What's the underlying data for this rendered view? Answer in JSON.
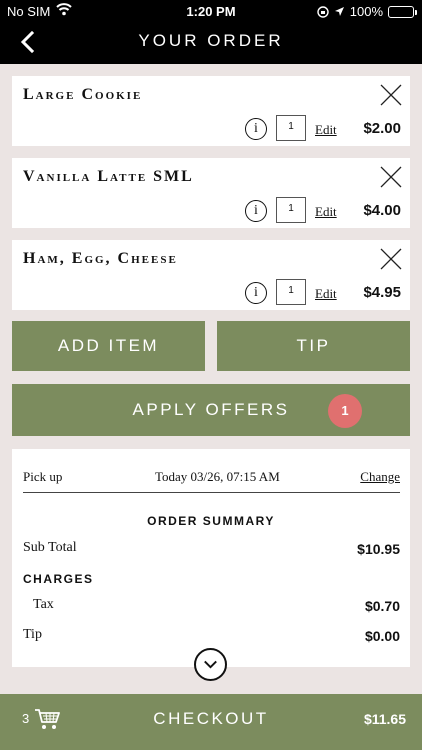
{
  "status_bar": {
    "carrier": "No SIM",
    "time": "1:20 PM",
    "battery": "100%"
  },
  "header": {
    "title": "YOUR ORDER"
  },
  "items": [
    {
      "name": "Large Cookie",
      "quantity": "1",
      "edit_label": "Edit",
      "price": "$2.00",
      "info_label": "i"
    },
    {
      "name": "Vanilla Latte SML",
      "quantity": "1",
      "edit_label": "Edit",
      "price": "$4.00",
      "info_label": "i"
    },
    {
      "name": "Ham, Egg, Cheese",
      "quantity": "1",
      "edit_label": "Edit",
      "price": "$4.95",
      "info_label": "i"
    }
  ],
  "actions": {
    "add_item": "ADD ITEM",
    "tip": "TIP",
    "apply_offers": "APPLY OFFERS",
    "offers_count": "1"
  },
  "summary": {
    "pickup_label": "Pick up",
    "pickup_time": "Today 03/26, 07:15 AM",
    "change_label": "Change",
    "title": "ORDER SUMMARY",
    "subtotal_label": "Sub Total",
    "subtotal_value": "$10.95",
    "charges_label": "CHARGES",
    "tax_label": "Tax",
    "tax_value": "$0.70",
    "tip_label": "Tip",
    "tip_value": "$0.00"
  },
  "footer": {
    "cart_count": "3",
    "checkout_label": "CHECKOUT",
    "total": "$11.65"
  },
  "colors": {
    "accent": "#7c8c5e",
    "badge": "#e0706f",
    "background": "#ebe4e3",
    "header": "#000000"
  }
}
